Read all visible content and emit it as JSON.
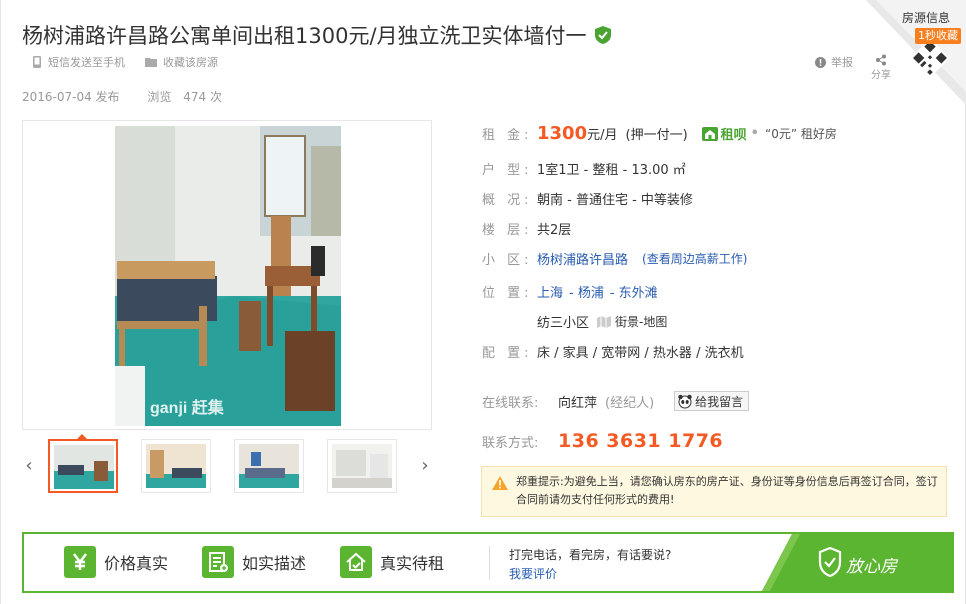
{
  "listing": {
    "title": "杨树浦路许昌路公寓单间出租1300元/月独立洗卫实体墙付一",
    "sms_label": "短信发送至手机",
    "fav_label": "收藏该房源",
    "report_label": "举报",
    "share_label": "分享",
    "publish_date": "2016-07-04 发布",
    "views_label": "浏览",
    "views_count": "474 次"
  },
  "corner": {
    "label": "房源信息",
    "tag": "1秒收藏"
  },
  "gallery": {
    "watermark": "ganji 赶集",
    "prev_icon": "chevron-left-icon",
    "next_icon": "chevron-right-icon",
    "thumb_count": 4
  },
  "details": {
    "rent_label": "租 金:",
    "price": "1300",
    "price_unit": "元/月",
    "payment": "(押一付一)",
    "zubei_brand": "租呗",
    "zubei_slogan": "“0元” 租好房",
    "type_label": "户 型:",
    "type_value": "1室1卫 - 整租 - 13.00 ㎡",
    "overview_label": "概 况:",
    "overview_value": "朝南 - 普通住宅 - 中等装修",
    "floor_label": "楼 层:",
    "floor_value": "共2层",
    "community_label": "小 区:",
    "community_value": "杨树浦路许昌路",
    "nearby_link": "(查看周边高薪工作)",
    "location_label": "位 置:",
    "location_city": "上海",
    "location_district": "- 杨浦",
    "location_area": "- 东外滩",
    "location_sub": "纺三小区",
    "streetview": "街景-地图",
    "amenities_label": "配 置:",
    "amenities_value": "床 / 家具 / 宽带网 / 热水器 / 洗衣机",
    "contact_label": "在线联系:",
    "agent_name": "向红萍",
    "agent_role": "(经纪人)",
    "message_button": "给我留言",
    "phone_label": "联系方式:",
    "phone": "136 3631 1776"
  },
  "warning": {
    "title": "郑重提示:",
    "text": "为避免上当，请您确认房东的房产证、身份证等身份信息后再签订合同，签订合同前请勿支付任何形式的费用!"
  },
  "guarantee": {
    "items": [
      "价格真实",
      "如实描述",
      "真实待租"
    ],
    "call_text": "打完电话，看完房，有话要说?",
    "eval_link": "我要评价",
    "badge": "放心房"
  },
  "colors": {
    "accent_orange": "#f55a25",
    "link_blue": "#2a5db0",
    "brand_green": "#5cb531"
  }
}
